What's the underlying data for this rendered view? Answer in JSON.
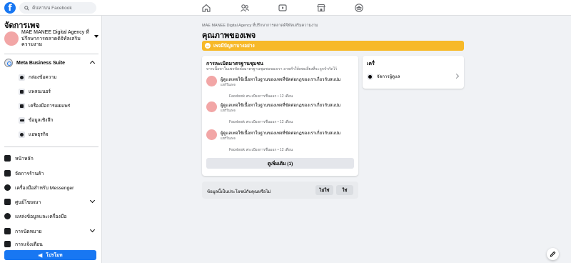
{
  "topbar": {
    "logo": "f",
    "search_placeholder": "ค้นหาบน Facebook",
    "nav_icons": [
      "home-icon",
      "people-icon",
      "video-icon",
      "marketplace-icon",
      "groups-icon"
    ]
  },
  "sidebar": {
    "title": "จัดการเพจ",
    "page_name": "MAE MANEE Digital Agency ที่ปรึกษาการตลาดดิจิทัลเสริมความงาม",
    "meta_business_suite": "Meta Business Suite",
    "sub_items": [
      {
        "label": "กล่องข้อความ",
        "icon": "chat-icon"
      },
      {
        "label": "แพลนเนอร์",
        "icon": "calendar-icon"
      },
      {
        "label": "เครื่องมือการเผยแพร่",
        "icon": "publishing-icon"
      },
      {
        "label": "ข้อมูลเชิงลึก",
        "icon": "insights-icon"
      },
      {
        "label": "แอพธุรกิจ",
        "icon": "business-apps-icon"
      }
    ],
    "main_items": [
      {
        "label": "หน้าหลัก",
        "icon": "home-icon"
      },
      {
        "label": "จัดการร้านค้า",
        "icon": "shop-icon"
      },
      {
        "label": "เครื่องมือสำหรับ Messenger",
        "icon": "messenger-icon"
      },
      {
        "label": "ศูนย์โฆษณา",
        "icon": "ad-center-icon"
      },
      {
        "label": "แหล่งข้อมูลและเครื่องมือ",
        "icon": "resources-icon"
      },
      {
        "label": "การนัดหมาย",
        "icon": "appointments-icon"
      },
      {
        "label": "การแจ้งเตือน",
        "icon": "notifications-icon"
      }
    ],
    "promote_label": "โปรโมท"
  },
  "main": {
    "breadcrumb": "MAE MANEE Digital Agency ที่ปรึกษาการตลาดดิจิทัลเสริมความงาม",
    "heading": "คุณภาพของเพจ",
    "banner_text": "เพจมีปัญหาบางอย่าง",
    "standards_card": {
      "title": "การละเมิดมาตรฐานชุมชน",
      "subtitle": "หากเนื้อหาในเพจขัดต่อมาตรฐานชุมชนของเรา อาจทำให้เพจเสี่ยงที่จะถูกจำกัดไว้",
      "violations": [
        {
          "title": "ผู้ดูแลเพจใช้เนื้อหาในฐานของเพจที่ขัดต่อกฎของเราเกี่ยวกับสแปม",
          "status": "แชร์ในเพจ",
          "meta": "Facebook สระเบียงการชื่นออก • 12 เดือน"
        },
        {
          "title": "ผู้ดูแลเพจใช้เนื้อหาในฐานของเพจที่ขัดต่อกฎของเราเกี่ยวกับสแปม",
          "status": "แชร์ในเพจ",
          "meta": "Facebook สระเบียงการชื่นออก • 12 เดือน"
        },
        {
          "title": "ผู้ดูแลเพจใช้เนื้อหาในฐานของเพจที่ขัดต่อกฎของเราเกี่ยวกับสแปม",
          "status": "แชร์ในเพจ",
          "meta": "Facebook สระเบียงการชื่นออก • 12 เดือน"
        }
      ],
      "see_more": "ดูเพิ่มเติม (1)"
    },
    "tools_card": {
      "title": "เครื่",
      "row_label": "จัดการผู้ดูแล"
    },
    "feedback": {
      "question": "ข้อมูลนี้เป็นประโยชน์กับคุณหรือไม่",
      "no_label": "ไม่ใช่",
      "yes_label": "ใช่"
    }
  }
}
